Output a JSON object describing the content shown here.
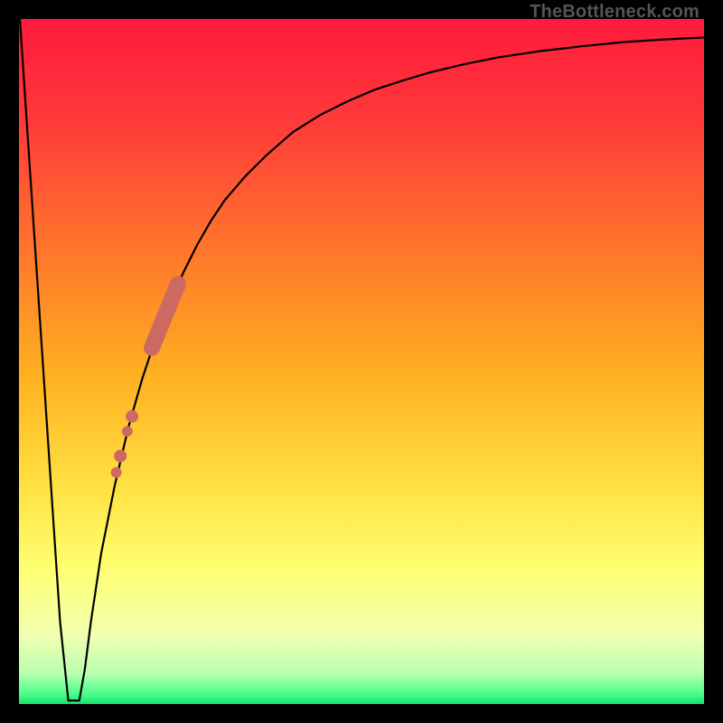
{
  "watermark": "TheBottleneck.com",
  "gradient_stops": [
    {
      "offset": 0.0,
      "color": "#ff1a3c"
    },
    {
      "offset": 0.15,
      "color": "#ff3a3a"
    },
    {
      "offset": 0.35,
      "color": "#ff7a2a"
    },
    {
      "offset": 0.52,
      "color": "#ffb020"
    },
    {
      "offset": 0.68,
      "color": "#ffe040"
    },
    {
      "offset": 0.8,
      "color": "#ffff70"
    },
    {
      "offset": 0.9,
      "color": "#f2ffb0"
    },
    {
      "offset": 0.955,
      "color": "#b9ffb0"
    },
    {
      "offset": 0.985,
      "color": "#4cff8a"
    },
    {
      "offset": 1.0,
      "color": "#15e070"
    }
  ],
  "colors": {
    "curve_stroke": "#000000",
    "marker_fill": "#cc6a62",
    "background": "#000000"
  },
  "chart_data": {
    "type": "line",
    "title": "",
    "xlabel": "",
    "ylabel": "",
    "ylim": [
      0,
      100
    ],
    "x": [
      0.0,
      0.02,
      0.04,
      0.06,
      0.072,
      0.08,
      0.088,
      0.096,
      0.105,
      0.12,
      0.14,
      0.16,
      0.18,
      0.2,
      0.22,
      0.24,
      0.26,
      0.28,
      0.3,
      0.33,
      0.36,
      0.4,
      0.44,
      0.48,
      0.52,
      0.56,
      0.6,
      0.65,
      0.7,
      0.76,
      0.82,
      0.88,
      0.94,
      1.0
    ],
    "values": [
      102.0,
      72.0,
      42.0,
      12.0,
      0.5,
      0.5,
      0.5,
      5.0,
      12.0,
      22.0,
      32.0,
      40.5,
      47.5,
      53.5,
      58.5,
      63.0,
      67.0,
      70.5,
      73.5,
      77.0,
      80.0,
      83.5,
      86.0,
      88.0,
      89.7,
      91.0,
      92.2,
      93.4,
      94.4,
      95.3,
      96.0,
      96.6,
      97.0,
      97.3
    ],
    "plateau": {
      "x_start": 0.072,
      "x_end": 0.088,
      "y": 0.5
    },
    "markers": [
      {
        "x": 0.198,
        "y": 53.0,
        "r": 8
      },
      {
        "x": 0.207,
        "y": 55.2,
        "r": 8
      },
      {
        "x": 0.214,
        "y": 57.0,
        "r": 7
      },
      {
        "x": 0.222,
        "y": 58.8,
        "r": 6
      },
      {
        "x": 0.229,
        "y": 60.5,
        "r": 8
      },
      {
        "x": 0.165,
        "y": 42.0,
        "r": 7
      },
      {
        "x": 0.158,
        "y": 39.8,
        "r": 6
      },
      {
        "x": 0.148,
        "y": 36.2,
        "r": 7
      },
      {
        "x": 0.142,
        "y": 33.8,
        "r": 6
      }
    ],
    "marker_band": {
      "points": [
        {
          "x": 0.194,
          "y": 52.0
        },
        {
          "x": 0.232,
          "y": 61.3
        }
      ],
      "width": 18
    }
  }
}
